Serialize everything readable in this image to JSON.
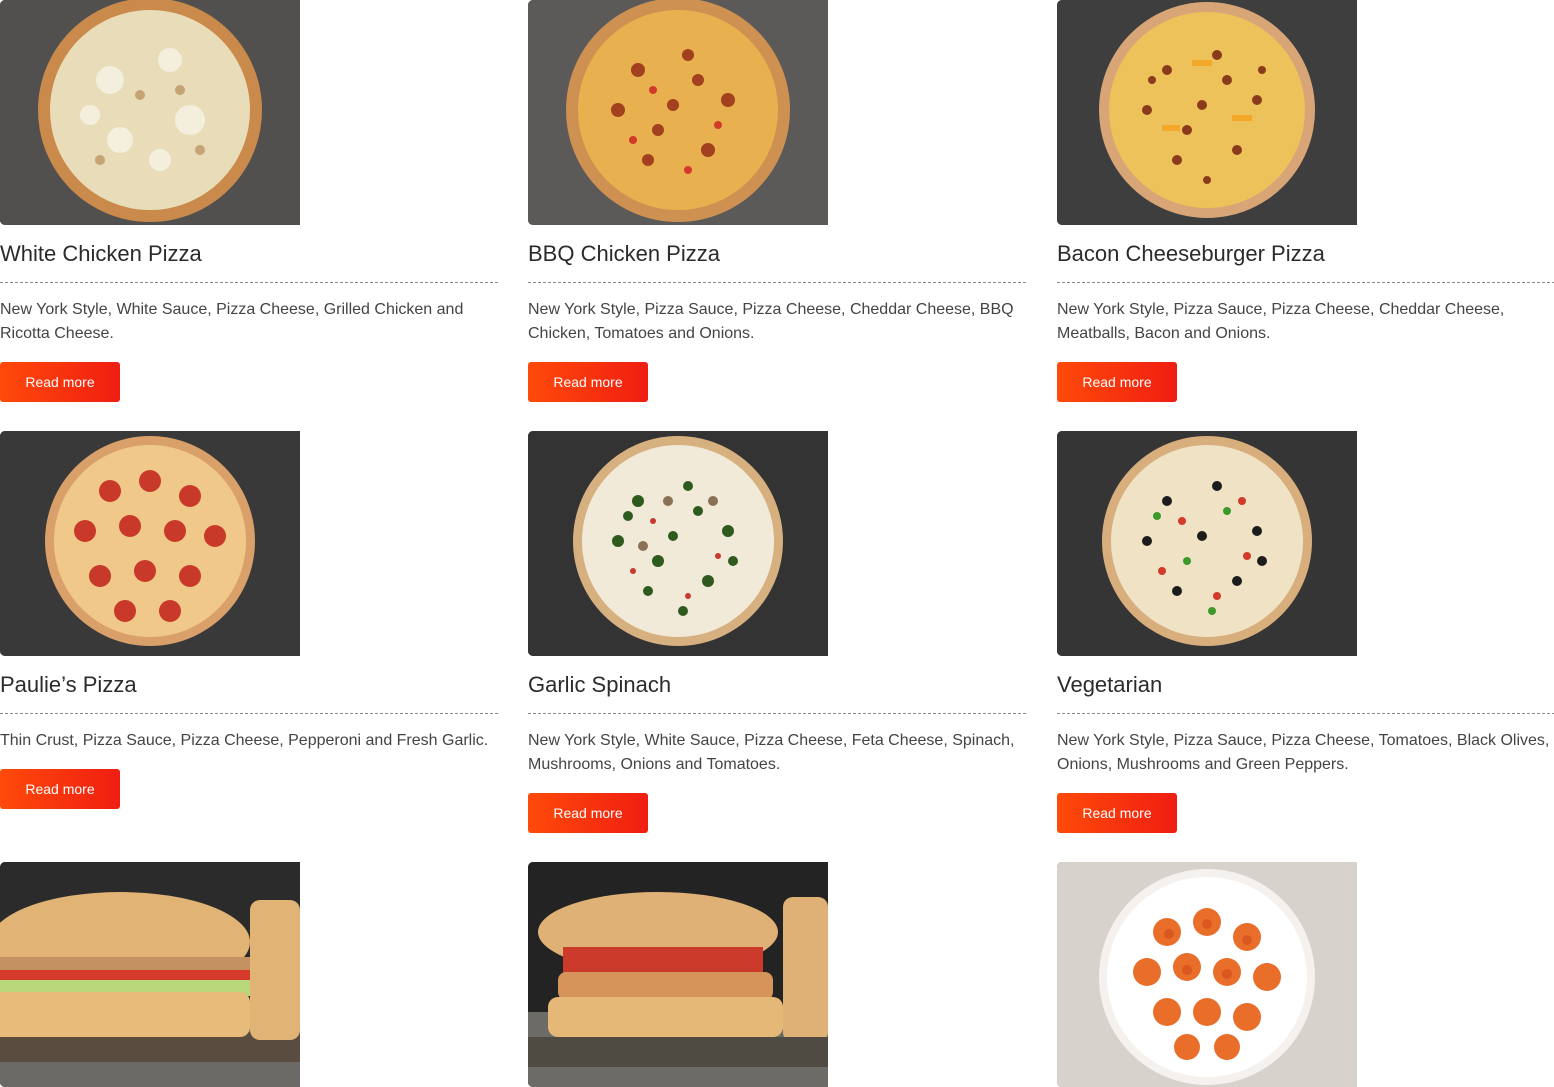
{
  "menu_items": [
    {
      "title": "White Chicken Pizza",
      "description": "New York Style, White Sauce, Pizza Cheese, Grilled Chicken and Ricotta Cheese.",
      "button": "Read more",
      "image_icon": "white-chicken-pizza-image"
    },
    {
      "title": "BBQ Chicken Pizza",
      "description": "New York Style, Pizza Sauce, Pizza Cheese, Cheddar Cheese, BBQ Chicken, Tomatoes and Onions.",
      "button": "Read more",
      "image_icon": "bbq-chicken-pizza-image"
    },
    {
      "title": "Bacon Cheeseburger Pizza",
      "description": "New York Style, Pizza Sauce, Pizza Cheese, Cheddar Cheese, Meatballs, Bacon and Onions.",
      "button": "Read more",
      "image_icon": "bacon-cheeseburger-pizza-image"
    },
    {
      "title": "Paulie’s Pizza",
      "description": "Thin Crust, Pizza Sauce, Pizza Cheese, Pepperoni and Fresh Garlic.",
      "button": "Read more",
      "image_icon": "paulies-pizza-image"
    },
    {
      "title": "Garlic Spinach",
      "description": "New York Style, White Sauce, Pizza Cheese, Feta Cheese, Spinach, Mushrooms, Onions and Tomatoes.",
      "button": "Read more",
      "image_icon": "garlic-spinach-pizza-image"
    },
    {
      "title": "Vegetarian",
      "description": "New York Style, Pizza Sauce, Pizza Cheese, Tomatoes, Black Olives, Onions, Mushrooms and Green Peppers.",
      "button": "Read more",
      "image_icon": "vegetarian-pizza-image"
    },
    {
      "image_icon": "chicken-sub-image"
    },
    {
      "image_icon": "chicken-parm-sub-image"
    },
    {
      "image_icon": "wings-plate-image"
    }
  ],
  "colors": {
    "button_start": "#ff4a0a",
    "button_end": "#f01e12",
    "title_text": "#2b2b2b",
    "divider": "#8a8a8a"
  }
}
